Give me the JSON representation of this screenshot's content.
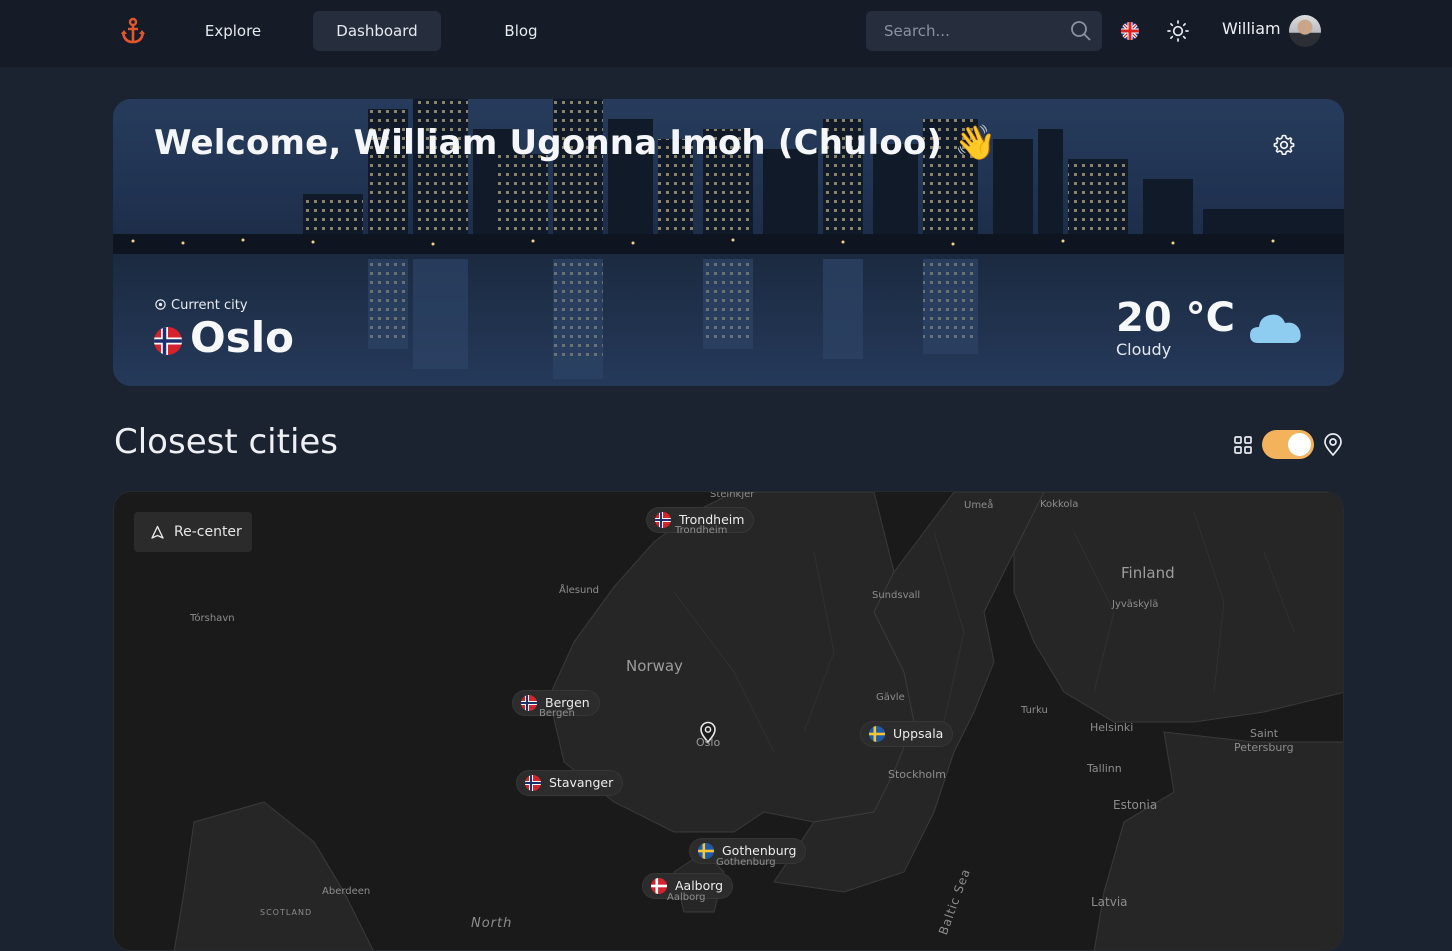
{
  "nav": {
    "explore": "Explore",
    "dashboard": "Dashboard",
    "blog": "Blog",
    "search_placeholder": "Search...",
    "username": "William",
    "brand_color": "#e4572e"
  },
  "hero": {
    "title": "Welcome, William Ugonna Imoh (Chuloo) 👋",
    "current_city_label": "Current city",
    "city": "Oslo",
    "temperature": "20 °C",
    "condition": "Cloudy"
  },
  "section": {
    "title": "Closest cities",
    "toggle_color": "#f3b25c",
    "toggle_on": true
  },
  "map": {
    "recenter_label": "Re-center",
    "center_label": "Oslo",
    "pills": [
      {
        "name": "Trondheim",
        "sub": "Trondheim",
        "flag": "NO"
      },
      {
        "name": "Bergen",
        "sub": "Bergen",
        "flag": "NO"
      },
      {
        "name": "Stavanger",
        "sub": "",
        "flag": "NO"
      },
      {
        "name": "Uppsala",
        "sub": "",
        "flag": "SE"
      },
      {
        "name": "Gothenburg",
        "sub": "Gothenburg",
        "flag": "SE"
      },
      {
        "name": "Aalborg",
        "sub": "Aalborg",
        "flag": "DK"
      }
    ],
    "places": {
      "steinkjer": "Steinkjer",
      "umea": "Umeå",
      "kokkola": "Kokkola",
      "alesund": "Ålesund",
      "sundsvall": "Sundsvall",
      "finland": "Finland",
      "jyvaskyla": "Jyväskylä",
      "torshavn": "Tórshavn",
      "norway": "Norway",
      "gavle": "Gävle",
      "turku": "Turku",
      "helsinki": "Helsinki",
      "saint": "Saint",
      "petersburg": "Petersburg",
      "stockholm": "Stockholm",
      "tallinn": "Tallinn",
      "estonia": "Estonia",
      "aberdeen": "Aberdeen",
      "scotland": "SCOTLAND",
      "north": "North",
      "baltic": "Baltic Sea",
      "latvia": "Latvia"
    }
  }
}
